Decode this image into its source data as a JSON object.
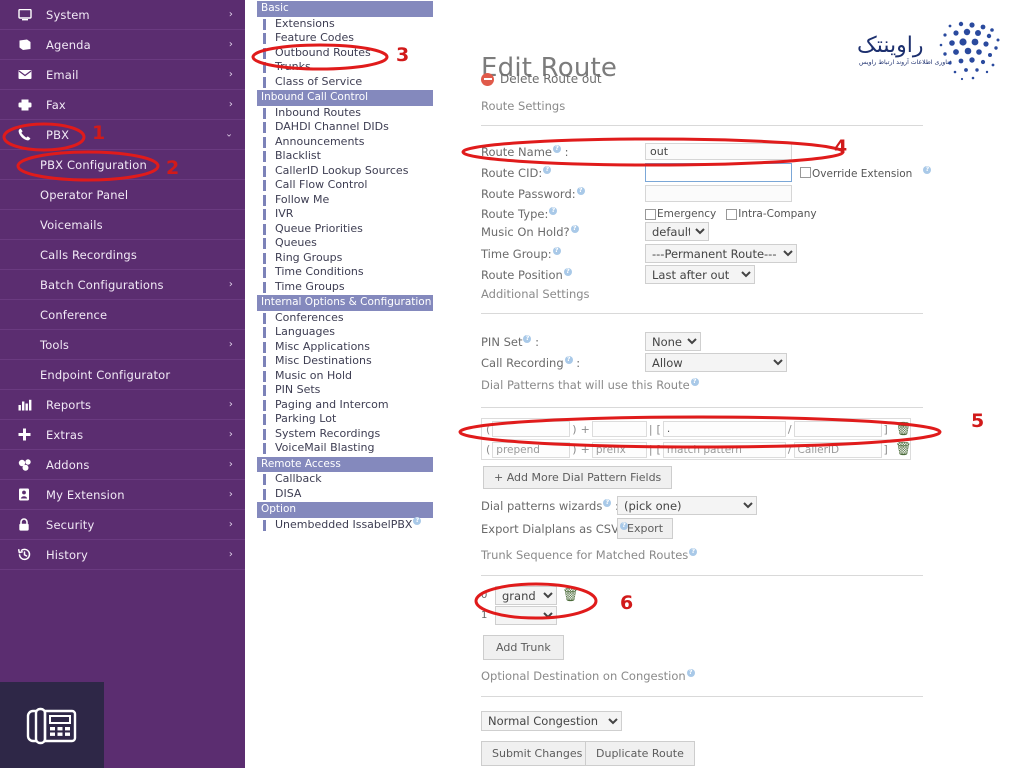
{
  "sidebar": {
    "items": [
      {
        "label": "System",
        "icon": "monitor-icon",
        "chevron": "right",
        "sub": false
      },
      {
        "label": "Agenda",
        "icon": "book-icon",
        "chevron": "right",
        "sub": false
      },
      {
        "label": "Email",
        "icon": "envelope-icon",
        "chevron": "right",
        "sub": false
      },
      {
        "label": "Fax",
        "icon": "printer-icon",
        "chevron": "right",
        "sub": false
      },
      {
        "label": "PBX",
        "icon": "phone-icon",
        "chevron": "down",
        "sub": false
      },
      {
        "label": "PBX Configuration",
        "icon": "",
        "chevron": "",
        "sub": true
      },
      {
        "label": "Operator Panel",
        "icon": "",
        "chevron": "",
        "sub": true
      },
      {
        "label": "Voicemails",
        "icon": "",
        "chevron": "",
        "sub": true
      },
      {
        "label": "Calls Recordings",
        "icon": "",
        "chevron": "",
        "sub": true
      },
      {
        "label": "Batch Configurations",
        "icon": "",
        "chevron": "right",
        "sub": true
      },
      {
        "label": "Conference",
        "icon": "",
        "chevron": "",
        "sub": true
      },
      {
        "label": "Tools",
        "icon": "",
        "chevron": "right",
        "sub": true
      },
      {
        "label": "Endpoint Configurator",
        "icon": "",
        "chevron": "",
        "sub": true
      },
      {
        "label": "Reports",
        "icon": "chart-icon",
        "chevron": "right",
        "sub": false
      },
      {
        "label": "Extras",
        "icon": "plus-icon",
        "chevron": "right",
        "sub": false
      },
      {
        "label": "Addons",
        "icon": "puzzle-icon",
        "chevron": "right",
        "sub": false
      },
      {
        "label": "My Extension",
        "icon": "contact-icon",
        "chevron": "right",
        "sub": false
      },
      {
        "label": "Security",
        "icon": "lock-icon",
        "chevron": "right",
        "sub": false
      },
      {
        "label": "History",
        "icon": "history-icon",
        "chevron": "right",
        "sub": false
      }
    ],
    "badge_icon": "desk-phone-icon"
  },
  "pbx_menu": {
    "sections": [
      {
        "group": "Basic",
        "items": [
          "Extensions",
          "Feature Codes",
          "Outbound Routes",
          "Trunks",
          "Class of Service"
        ]
      },
      {
        "group": "Inbound Call Control",
        "items": [
          "Inbound Routes",
          "DAHDI Channel DIDs",
          "Announcements",
          "Blacklist",
          "CallerID Lookup Sources",
          "Call Flow Control",
          "Follow Me",
          "IVR",
          "Queue Priorities",
          "Queues",
          "Ring Groups",
          "Time Conditions",
          "Time Groups"
        ]
      },
      {
        "group": "Internal Options & Configuration",
        "items": [
          "Conferences",
          "Languages",
          "Misc Applications",
          "Misc Destinations",
          "Music on Hold",
          "PIN Sets",
          "Paging and Intercom",
          "Parking Lot",
          "System Recordings",
          "VoiceMail Blasting"
        ]
      },
      {
        "group": "Remote Access",
        "items": [
          "Callback",
          "DISA"
        ]
      },
      {
        "group": "Option",
        "items": [
          "Unembedded IssabelPBX"
        ]
      }
    ]
  },
  "main": {
    "title": "Edit Route",
    "delete_link": "Delete Route out",
    "route_settings_label": "Route Settings",
    "additional_settings_label": "Additional Settings",
    "dial_patterns_label": "Dial Patterns that will use this Route",
    "trunk_sequence_label": "Trunk Sequence for Matched Routes",
    "optional_destination_label": "Optional Destination on Congestion",
    "fields": {
      "route_name_label": "Route Name",
      "route_name_value": "out",
      "route_cid_label": "Route CID:",
      "route_cid_value": "",
      "override_extension_label": "Override Extension",
      "route_password_label": "Route Password:",
      "route_password_value": "",
      "route_type_label": "Route Type:",
      "route_type_emergency": "Emergency",
      "route_type_intra": "Intra-Company",
      "music_on_hold_label": "Music On Hold?",
      "music_on_hold_value": "default",
      "time_group_label": "Time Group:",
      "time_group_value": "---Permanent Route---",
      "route_position_label": "Route Position",
      "route_position_value": "Last after out",
      "pin_set_label": "PIN Set",
      "pin_set_value": "None",
      "call_recording_label": "Call Recording",
      "call_recording_value": "Allow",
      "dial_wizards_label": "Dial patterns wizards",
      "dial_wizards_value": "(pick one)",
      "export_csv_label": "Export Dialplans as CSV",
      "export_button": "Export"
    },
    "dial_patterns": {
      "rows": [
        {
          "prepend": "",
          "prefix": "",
          "match": ".",
          "cid": "",
          "is_placeholder": false
        },
        {
          "prepend": "prepend",
          "prefix": "prefix",
          "match": "match pattern",
          "cid": "CallerID",
          "is_placeholder": true
        }
      ],
      "add_button": "+ Add More Dial Pattern Fields",
      "trash_icon": "trash-icon"
    },
    "trunk_sequence": {
      "rows": [
        {
          "index": "0",
          "value": "grand"
        },
        {
          "index": "1",
          "value": ""
        }
      ],
      "add_button": "Add Trunk"
    },
    "congestion": {
      "value": "Normal Congestion"
    },
    "buttons": {
      "submit": "Submit Changes",
      "duplicate": "Duplicate Route"
    }
  },
  "logo": {
    "wordmark": "راوینـتـک",
    "tagline": "فناوری اطلاعات آروند ارتباط راویس"
  },
  "annotations": {
    "numbers": [
      "1",
      "2",
      "3",
      "4",
      "5",
      "6"
    ],
    "color": "#e01b1b"
  }
}
